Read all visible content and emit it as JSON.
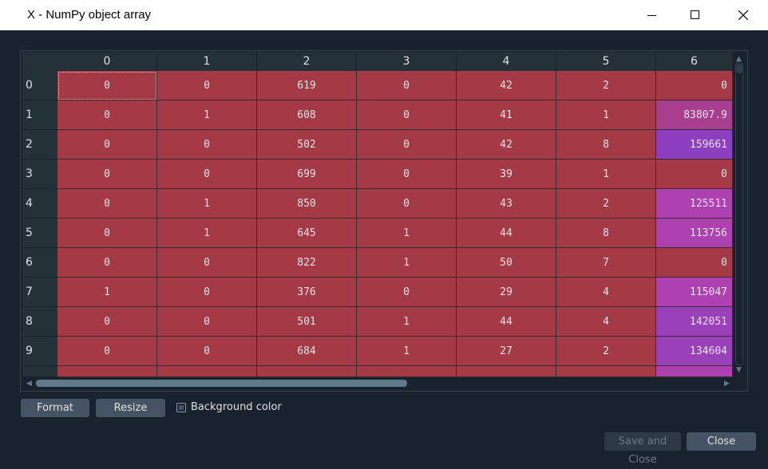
{
  "window": {
    "title": "X - NumPy object array",
    "minimize_icon": "minimize-icon",
    "maximize_icon": "maximize-icon",
    "close_icon": "close-icon"
  },
  "table": {
    "columns": [
      "0",
      "1",
      "2",
      "3",
      "4",
      "5",
      "6"
    ],
    "rows": [
      {
        "label": "0",
        "cells": [
          "0",
          "0",
          "619",
          "0",
          "42",
          "2",
          "0"
        ]
      },
      {
        "label": "1",
        "cells": [
          "0",
          "1",
          "608",
          "0",
          "41",
          "1",
          "83807.9"
        ]
      },
      {
        "label": "2",
        "cells": [
          "0",
          "0",
          "502",
          "0",
          "42",
          "8",
          "159661"
        ]
      },
      {
        "label": "3",
        "cells": [
          "0",
          "0",
          "699",
          "0",
          "39",
          "1",
          "0"
        ]
      },
      {
        "label": "4",
        "cells": [
          "0",
          "1",
          "850",
          "0",
          "43",
          "2",
          "125511"
        ]
      },
      {
        "label": "5",
        "cells": [
          "0",
          "1",
          "645",
          "1",
          "44",
          "8",
          "113756"
        ]
      },
      {
        "label": "6",
        "cells": [
          "0",
          "0",
          "822",
          "1",
          "50",
          "7",
          "0"
        ]
      },
      {
        "label": "7",
        "cells": [
          "1",
          "0",
          "376",
          "0",
          "29",
          "4",
          "115047"
        ]
      },
      {
        "label": "8",
        "cells": [
          "0",
          "0",
          "501",
          "1",
          "44",
          "4",
          "142051"
        ]
      },
      {
        "label": "9",
        "cells": [
          "0",
          "0",
          "684",
          "1",
          "27",
          "2",
          "134604"
        ]
      }
    ],
    "colors": {
      "low": "#a33a46",
      "mid": "#a83e8e",
      "high_a": "#ad41b0",
      "high_b": "#8c3fbf"
    }
  },
  "controls": {
    "format_label": "Format",
    "resize_label": "Resize",
    "background_color_label": "Background color",
    "background_color_checked": true,
    "save_close_label": "Save and Close",
    "close_label": "Close"
  }
}
